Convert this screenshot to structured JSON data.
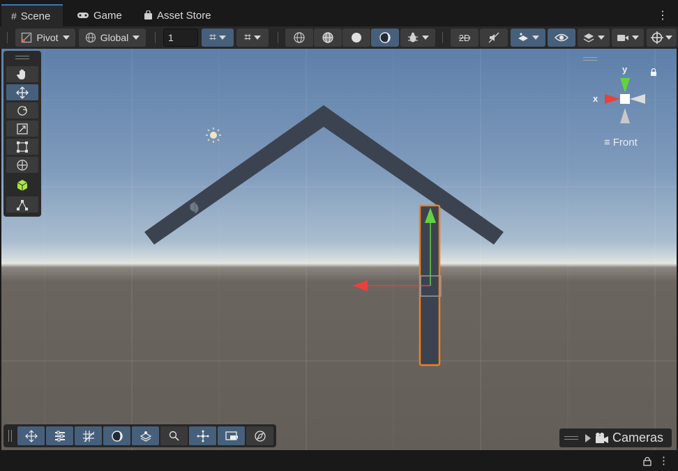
{
  "tabs": [
    {
      "label": "Scene",
      "icon": "hash-icon"
    },
    {
      "label": "Game",
      "icon": "gamepad-icon"
    },
    {
      "label": "Asset Store",
      "icon": "bag-icon"
    }
  ],
  "toolbar": {
    "pivot_label": "Pivot",
    "global_label": "Global",
    "grid_size_value": "1"
  },
  "gizmo": {
    "x_label": "x",
    "y_label": "y",
    "view_label": "Front"
  },
  "cameras_label": "Cameras",
  "colors": {
    "accent": "#3a79bb",
    "active_button": "#46607c",
    "selection_outline": "#f07f1f",
    "x_axis": "#e8413b",
    "y_axis": "#62d33d"
  }
}
